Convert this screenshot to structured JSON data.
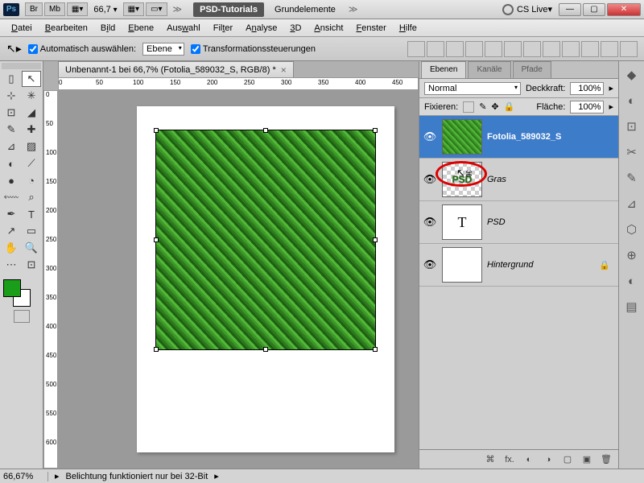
{
  "titlebar": {
    "ps": "Ps",
    "buttons": [
      "Br",
      "Mb"
    ],
    "zoom": "66,7",
    "breadcrumb_active": "PSD-Tutorials",
    "breadcrumb_item": "Grundelemente",
    "cslive": "CS Live"
  },
  "menus": [
    "Datei",
    "Bearbeiten",
    "Bild",
    "Ebene",
    "Auswahl",
    "Filter",
    "Analyse",
    "3D",
    "Ansicht",
    "Fenster",
    "Hilfe"
  ],
  "options": {
    "auto_select": "Automatisch auswählen:",
    "auto_select_mode": "Ebene",
    "transform_controls": "Transformationssteuerungen"
  },
  "document": {
    "tab": "Unbenannt-1 bei 66,7% (Fotolia_589032_S, RGB/8) *"
  },
  "ruler_h": [
    "0",
    "50",
    "100",
    "150",
    "200",
    "250",
    "300",
    "350",
    "400",
    "450"
  ],
  "ruler_v": [
    "0",
    "50",
    "100",
    "150",
    "200",
    "250",
    "300",
    "350",
    "400",
    "450",
    "500",
    "550",
    "600"
  ],
  "panel": {
    "tabs": [
      "Ebenen",
      "Kanäle",
      "Pfade"
    ],
    "blend_mode": "Normal",
    "opacity_label": "Deckkraft:",
    "opacity": "100%",
    "lock_label": "Fixieren:",
    "fill_label": "Fläche:",
    "fill": "100%",
    "layers": [
      {
        "name": "Fotolia_589032_S",
        "selected": true,
        "visible": true,
        "thumb": "grass"
      },
      {
        "name": "Gras",
        "selected": false,
        "visible": true,
        "thumb": "psd"
      },
      {
        "name": "PSD",
        "selected": false,
        "visible": true,
        "thumb": "T"
      },
      {
        "name": "Hintergrund",
        "selected": false,
        "visible": true,
        "thumb": "white",
        "locked": true
      }
    ]
  },
  "status": {
    "zoom": "66,67%",
    "msg": "Belichtung funktioniert nur bei 32-Bit"
  },
  "tools": [
    "▯",
    "↖",
    "⊹",
    "✳",
    "⊡",
    "◢",
    "✎",
    "✚",
    "⊿",
    "▨",
    "◐",
    "⟋",
    "●",
    "◔",
    "⬳",
    "⌕",
    "✒",
    "T",
    "↗",
    "▭",
    "✋",
    "🔍",
    "⋯",
    "⊡"
  ]
}
